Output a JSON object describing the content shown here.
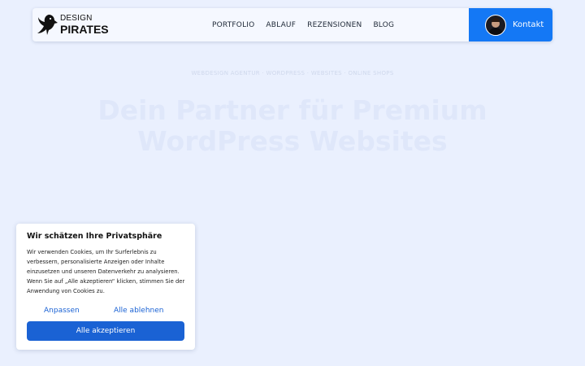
{
  "header": {
    "logo": {
      "line1": "DESIGN",
      "line2": "PIRATES",
      "icon": "parrot-icon"
    },
    "nav": [
      "PORTFOLIO",
      "ABLAUF",
      "REZENSIONEN",
      "BLOG"
    ],
    "contact_label": "Kontakt",
    "accent": "#1478f5"
  },
  "hero": {
    "breadcrumb": "WEBDESIGN AGENTUR · WORDPRESS · WEBSITES · ONLINE SHOPS",
    "title_line1": "Dein Partner für Premium",
    "title_line2": "WordPress Websites"
  },
  "cookie_banner": {
    "title": "Wir schätzen Ihre Privatsphäre",
    "text": "Wir verwenden Cookies, um Ihr Surferlebnis zu verbessern, personalisierte Anzeigen oder Inhalte einzusetzen und unseren Datenverkehr zu analysieren. Wenn Sie auf „Alle akzeptieren“ klicken, stimmen Sie der Anwendung von Cookies zu.",
    "customize_label": "Anpassen",
    "decline_label": "Alle ablehnen",
    "accept_label": "Alle akzeptieren",
    "accent": "#1a62d4"
  }
}
